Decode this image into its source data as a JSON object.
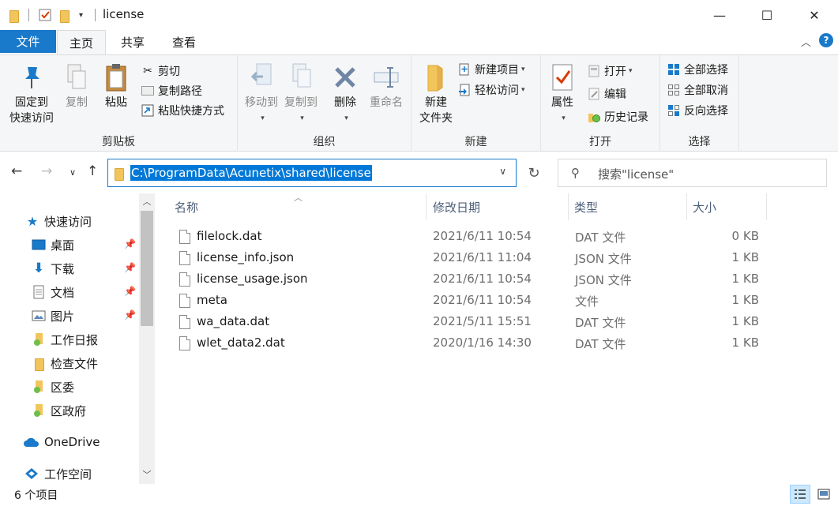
{
  "window": {
    "title": "license",
    "minimize": "—",
    "maximize": "☐",
    "close": "✕"
  },
  "ribbon_tabs": {
    "file": "文件",
    "home": "主页",
    "share": "共享",
    "view": "查看"
  },
  "ribbon": {
    "clipboard": {
      "label": "剪贴板",
      "pin_line1": "固定到",
      "pin_line2": "快速访问",
      "copy": "复制",
      "paste": "粘贴",
      "cut": "剪切",
      "copy_path": "复制路径",
      "paste_shortcut": "粘贴快捷方式"
    },
    "organize": {
      "label": "组织",
      "move_to": "移动到",
      "copy_to": "复制到",
      "delete": "删除",
      "rename": "重命名"
    },
    "new": {
      "label": "新建",
      "new_folder_line1": "新建",
      "new_folder_line2": "文件夹",
      "new_item": "新建项目",
      "easy_access": "轻松访问"
    },
    "open": {
      "label": "打开",
      "properties": "属性",
      "open": "打开",
      "edit": "编辑",
      "history": "历史记录"
    },
    "select": {
      "label": "选择",
      "select_all": "全部选择",
      "select_none": "全部取消",
      "invert": "反向选择"
    }
  },
  "address": {
    "path": "C:\\ProgramData\\Acunetix\\shared\\license"
  },
  "search": {
    "placeholder": "搜索\"license\""
  },
  "nav": {
    "quick_access": "快速访问",
    "desktop": "桌面",
    "downloads": "下载",
    "documents": "文档",
    "pictures": "图片",
    "daily_report": "工作日报",
    "inspection_files": "检查文件",
    "district_committee": "区委",
    "district_government": "区政府",
    "onedrive": "OneDrive",
    "workspace": "工作空间"
  },
  "columns": {
    "name": "名称",
    "modified": "修改日期",
    "type": "类型",
    "size": "大小"
  },
  "files": [
    {
      "name": "filelock.dat",
      "modified": "2021/6/11 10:54",
      "type": "DAT 文件",
      "size": "0 KB"
    },
    {
      "name": "license_info.json",
      "modified": "2021/6/11 11:04",
      "type": "JSON 文件",
      "size": "1 KB"
    },
    {
      "name": "license_usage.json",
      "modified": "2021/6/11 10:54",
      "type": "JSON 文件",
      "size": "1 KB"
    },
    {
      "name": "meta",
      "modified": "2021/6/11 10:54",
      "type": "文件",
      "size": "1 KB"
    },
    {
      "name": "wa_data.dat",
      "modified": "2021/5/11 15:51",
      "type": "DAT 文件",
      "size": "1 KB"
    },
    {
      "name": "wlet_data2.dat",
      "modified": "2020/1/16 14:30",
      "type": "DAT 文件",
      "size": "1 KB"
    }
  ],
  "status": {
    "item_count": "6 个项目"
  },
  "colors": {
    "accent": "#1979ca",
    "folder": "#f2c55c",
    "selection": "#0078d7"
  }
}
